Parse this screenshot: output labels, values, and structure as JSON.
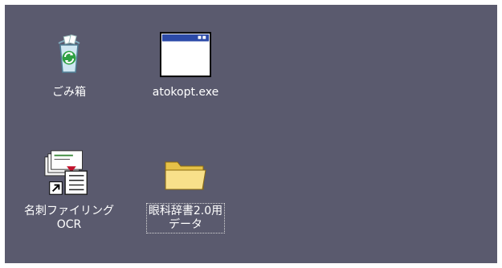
{
  "desktop": {
    "background_color": "#5a5a6e",
    "icons": [
      {
        "icon": "recycle-bin-icon",
        "label_lines": [
          "ごみ箱"
        ]
      },
      {
        "icon": "application-window-icon",
        "label_lines": [
          "atokopt.exe"
        ]
      },
      {
        "icon": "card-filing-shortcut-icon",
        "label_lines": [
          "名刺ファイリング",
          "OCR"
        ]
      },
      {
        "icon": "folder-icon",
        "label_lines": [
          "眼科辞書2.0用",
          "データ"
        ],
        "focused": true
      }
    ]
  }
}
